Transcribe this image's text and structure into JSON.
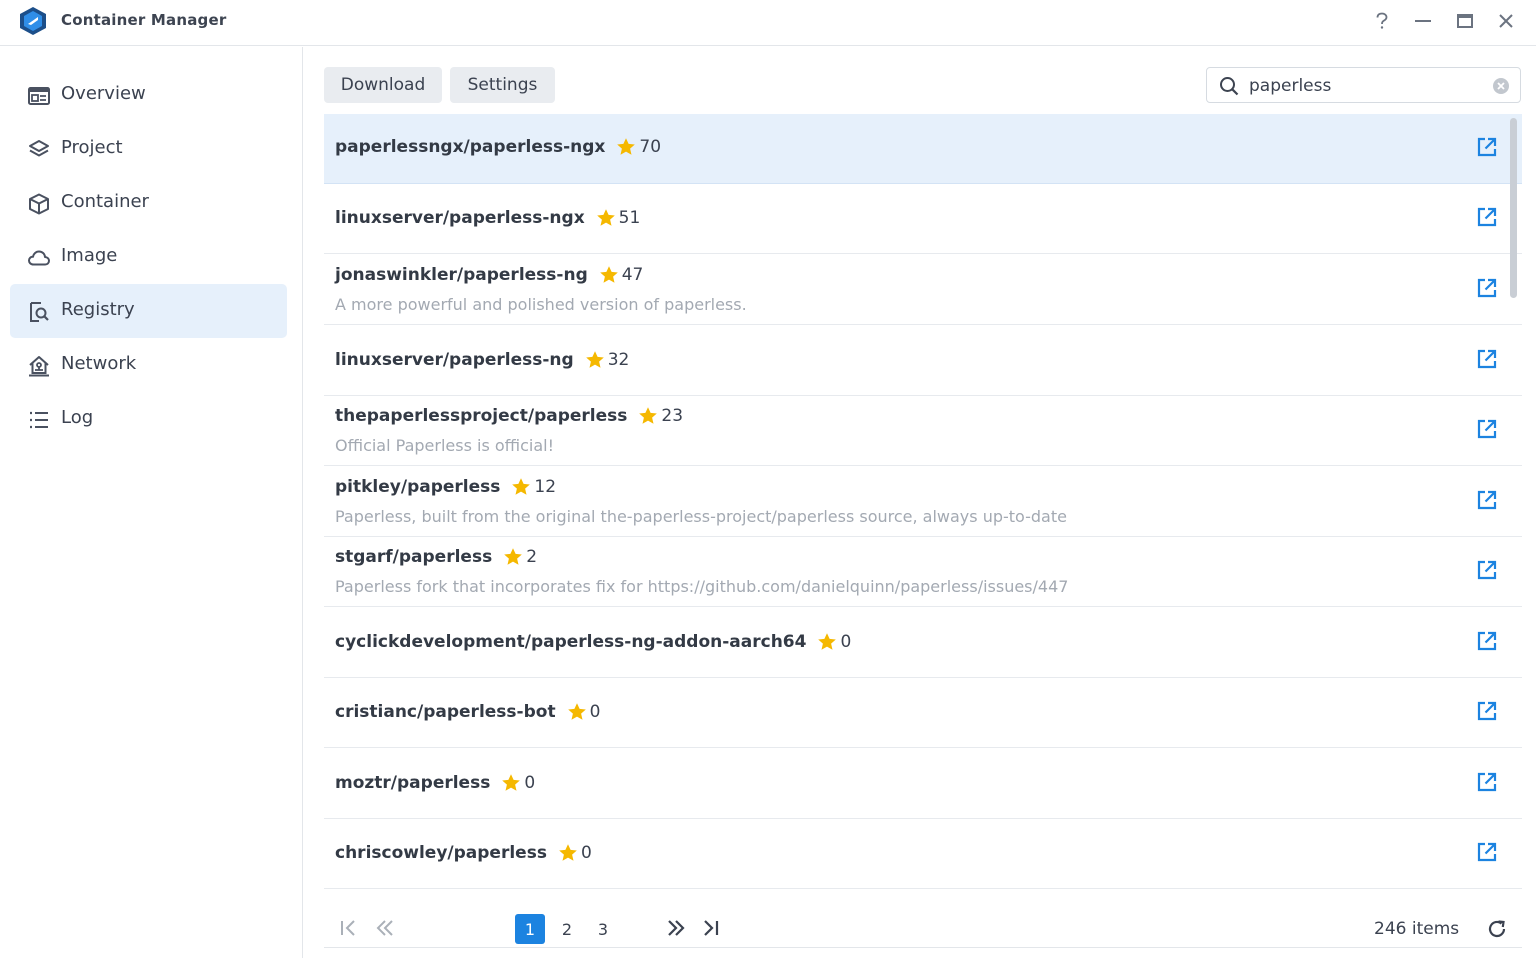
{
  "window": {
    "title": "Container Manager",
    "controls": [
      "help-icon",
      "minimize-icon",
      "maximize-icon",
      "close-icon"
    ]
  },
  "sidebar": {
    "items": [
      {
        "label": "Overview",
        "icon": "overview-icon",
        "active": false
      },
      {
        "label": "Project",
        "icon": "layers-icon",
        "active": false
      },
      {
        "label": "Container",
        "icon": "cube-icon",
        "active": false
      },
      {
        "label": "Image",
        "icon": "cloud-icon",
        "active": false
      },
      {
        "label": "Registry",
        "icon": "registry-search-icon",
        "active": true
      },
      {
        "label": "Network",
        "icon": "network-icon",
        "active": false
      },
      {
        "label": "Log",
        "icon": "list-icon",
        "active": false
      }
    ]
  },
  "toolbar": {
    "download_label": "Download",
    "settings_label": "Settings"
  },
  "search": {
    "value": "paperless",
    "placeholder": ""
  },
  "results": [
    {
      "name": "paperlessngx/paperless-ngx",
      "stars": "70",
      "description": "",
      "selected": true
    },
    {
      "name": "linuxserver/paperless-ngx",
      "stars": "51",
      "description": ""
    },
    {
      "name": "jonaswinkler/paperless-ng",
      "stars": "47",
      "description": "A more powerful and polished version of paperless."
    },
    {
      "name": "linuxserver/paperless-ng",
      "stars": "32",
      "description": ""
    },
    {
      "name": "thepaperlessproject/paperless",
      "stars": "23",
      "description": "Official Paperless is official!"
    },
    {
      "name": "pitkley/paperless",
      "stars": "12",
      "description": "Paperless, built from the original the-paperless-project/paperless source, always up-to-date"
    },
    {
      "name": "stgarf/paperless",
      "stars": "2",
      "description": "Paperless fork that incorporates fix for https://github.com/danielquinn/paperless/issues/447"
    },
    {
      "name": "cyclickdevelopment/paperless-ng-addon-aarch64",
      "stars": "0",
      "description": ""
    },
    {
      "name": "cristianc/paperless-bot",
      "stars": "0",
      "description": ""
    },
    {
      "name": "moztr/paperless",
      "stars": "0",
      "description": ""
    },
    {
      "name": "chriscowley/paperless",
      "stars": "0",
      "description": ""
    }
  ],
  "pagination": {
    "pages": [
      "1",
      "2",
      "3"
    ],
    "current": "1",
    "item_count": "246 items"
  },
  "colors": {
    "accent": "#1c83e0",
    "star": "#f5b800",
    "selected_row": "#e6f0fb"
  }
}
